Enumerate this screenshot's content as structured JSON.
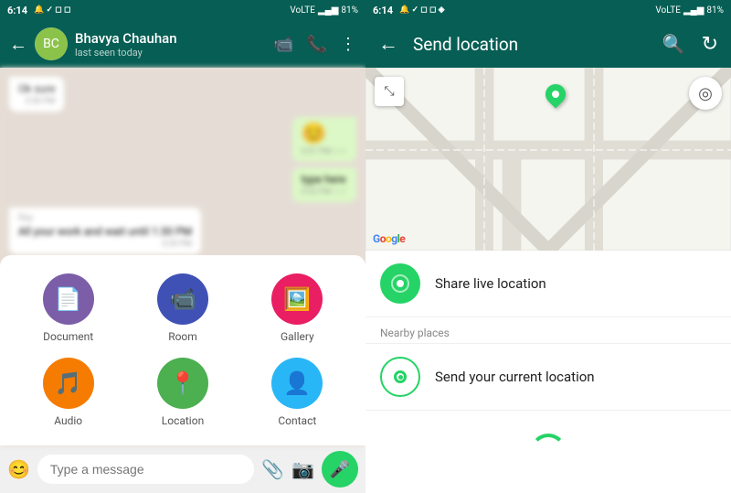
{
  "left": {
    "statusBar": {
      "time": "6:14",
      "battery": "81%",
      "network": "VoLTE"
    },
    "header": {
      "contactName": "Bhavya Chauhan",
      "contactStatus": "last seen today",
      "avatarText": "BC"
    },
    "messages": [
      {
        "type": "in",
        "text": "Ok sure",
        "time": "3:30 PM"
      },
      {
        "type": "out",
        "text": "",
        "time": "3:31 PM",
        "emoji": "😊"
      },
      {
        "type": "out",
        "text": "type here",
        "time": "3:32 PM"
      },
      {
        "type": "in",
        "text": "Ray",
        "time": "3:33 PM"
      },
      {
        "type": "in",
        "text": "All your work and wait until 1:30 PM",
        "time": "3:35 PM"
      }
    ],
    "attachMenu": {
      "items": [
        {
          "id": "document",
          "label": "Document",
          "color": "#7b5ea7",
          "icon": "📄"
        },
        {
          "id": "room",
          "label": "Room",
          "color": "#3f51b5",
          "icon": "📹"
        },
        {
          "id": "gallery",
          "label": "Gallery",
          "color": "#e91e63",
          "icon": "🖼️"
        },
        {
          "id": "audio",
          "label": "Audio",
          "color": "#f57c00",
          "icon": "🎵"
        },
        {
          "id": "location",
          "label": "Location",
          "color": "#4caf50",
          "icon": "📍"
        },
        {
          "id": "contact",
          "label": "Contact",
          "color": "#29b6f6",
          "icon": "👤"
        }
      ]
    },
    "inputBar": {
      "placeholder": "Type a message",
      "emojiIcon": "😊",
      "attachIcon": "📎",
      "cameraIcon": "📷",
      "micIcon": "🎤"
    }
  },
  "right": {
    "statusBar": {
      "time": "6:14",
      "battery": "81%",
      "network": "VoLTE"
    },
    "header": {
      "title": "Send location",
      "backIcon": "←",
      "searchIcon": "🔍",
      "refreshIcon": "↻"
    },
    "map": {
      "expandIcon": "⤡",
      "locateIcon": "◎",
      "googleLabel": "Google"
    },
    "options": [
      {
        "id": "share-live",
        "title": "Share live location",
        "subtitle": "",
        "iconType": "live"
      },
      {
        "id": "send-current",
        "title": "Send your current location",
        "subtitle": "",
        "iconType": "current"
      }
    ],
    "nearbyLabel": "Nearby places",
    "loading": true
  }
}
